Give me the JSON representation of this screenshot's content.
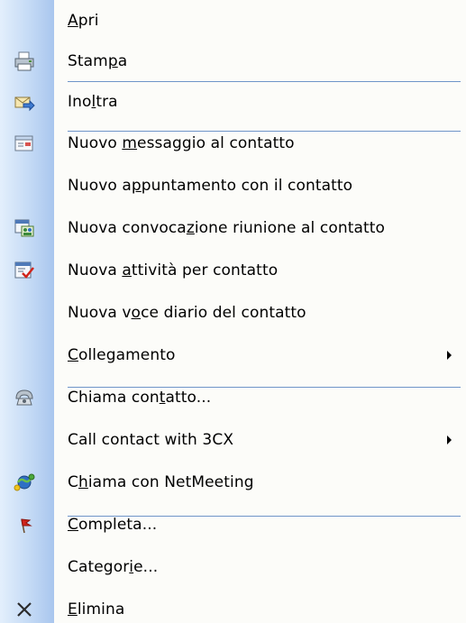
{
  "menu": {
    "items": [
      {
        "name": "menu-item-apri",
        "pre": "",
        "u": "A",
        "post": "pri",
        "icon": "",
        "submenu": false
      },
      {
        "name": "menu-item-stampa",
        "pre": "Stam",
        "u": "p",
        "post": "a",
        "icon": "printer-icon",
        "submenu": false
      },
      {
        "name": "menu-item-inoltra",
        "pre": "Ino",
        "u": "l",
        "post": "tra",
        "icon": "forward-mail-icon",
        "submenu": false
      },
      {
        "name": "menu-item-nuovo-messaggio",
        "pre": "Nuovo ",
        "u": "m",
        "post": "essaggio al contatto",
        "icon": "new-message-icon",
        "submenu": false
      },
      {
        "name": "menu-item-nuovo-appuntamento",
        "pre": "Nuovo a",
        "u": "p",
        "post": "puntamento con il contatto",
        "icon": "",
        "submenu": false
      },
      {
        "name": "menu-item-nuova-convocazione",
        "pre": "Nuova convoca",
        "u": "z",
        "post": "ione riunione al contatto",
        "icon": "meeting-request-icon",
        "submenu": false
      },
      {
        "name": "menu-item-nuova-attivita",
        "pre": "Nuova ",
        "u": "a",
        "post": "ttività per contatto",
        "icon": "task-icon",
        "submenu": false
      },
      {
        "name": "menu-item-nuova-voce-diario",
        "pre": "Nuova v",
        "u": "o",
        "post": "ce diario del contatto",
        "icon": "",
        "submenu": false
      },
      {
        "name": "menu-item-collegamento",
        "pre": "",
        "u": "C",
        "post": "ollegamento",
        "icon": "",
        "submenu": true
      },
      {
        "name": "menu-item-chiama-contatto",
        "pre": "Chiama con",
        "u": "t",
        "post": "atto...",
        "icon": "telephone-icon",
        "submenu": false
      },
      {
        "name": "menu-item-call-3cx",
        "pre": "Call contact with 3CX",
        "u": "",
        "post": "",
        "icon": "",
        "submenu": true
      },
      {
        "name": "menu-item-netmeeting",
        "pre": "C",
        "u": "h",
        "post": "iama con NetMeeting",
        "icon": "netmeeting-icon",
        "submenu": false
      },
      {
        "name": "menu-item-completa",
        "pre": "",
        "u": "C",
        "post": "ompleta...",
        "icon": "flag-icon",
        "submenu": false
      },
      {
        "name": "menu-item-categorie",
        "pre": "Categor",
        "u": "i",
        "post": "e...",
        "icon": "",
        "submenu": false
      },
      {
        "name": "menu-item-elimina",
        "pre": "",
        "u": "E",
        "post": "limina",
        "icon": "delete-icon",
        "submenu": false
      }
    ],
    "colors": {
      "gutter_light": "#e3effc",
      "gutter_dark": "#a9c6ee",
      "separator": "#6f95c9",
      "flag_red": "#d0241b"
    }
  }
}
